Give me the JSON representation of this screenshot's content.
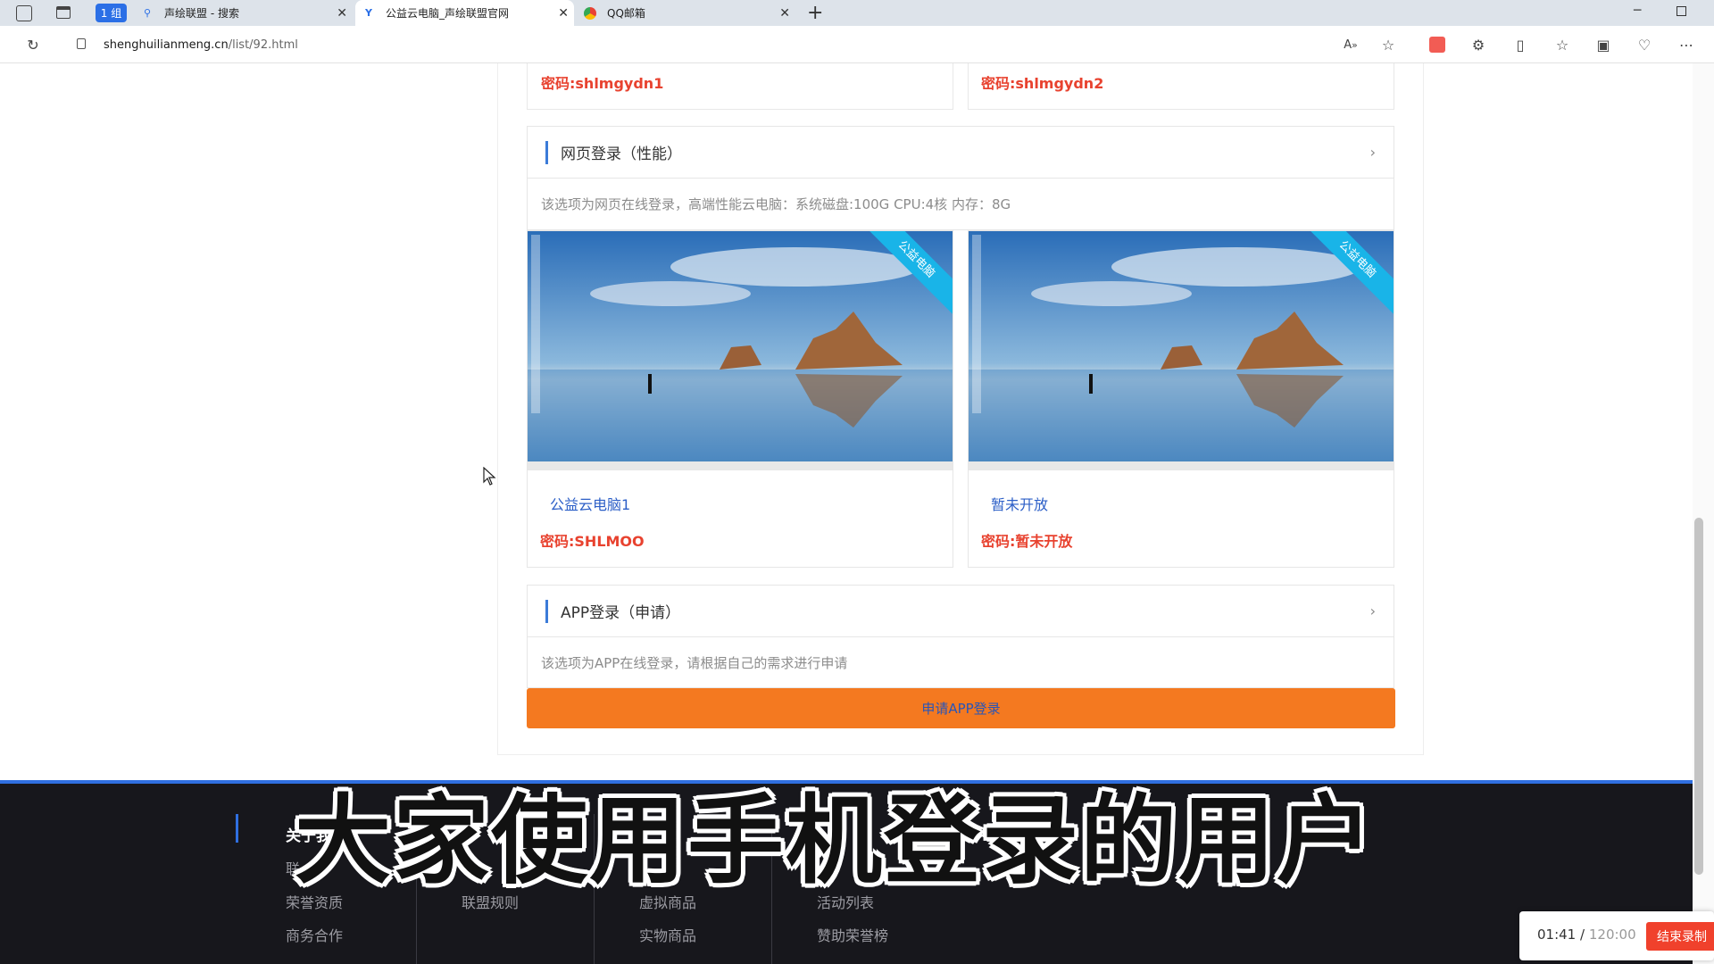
{
  "browser": {
    "tab_group_label": "1 组",
    "tabs": [
      {
        "title": "声绘联盟 - 搜索",
        "icon": "search-icon"
      },
      {
        "title": "公益云电脑_声绘联盟官网",
        "icon": "site-logo-icon"
      },
      {
        "title": "QQ邮箱",
        "icon": "chrome-icon"
      }
    ],
    "url_host": "shenghuilianmeng.cn",
    "url_path": "/list/92.html"
  },
  "top_row": {
    "pwd_left": "密码:shlmgydn1",
    "pwd_right": "密码:shlmgydn2"
  },
  "web_section": {
    "title": "网页登录（性能）",
    "description": "该选项为网页在线登录，高端性能云电脑：系统磁盘:100G CPU:4核 内存：8G",
    "cards": [
      {
        "name": "公益云电脑1",
        "password": "密码:SHLMOO",
        "ribbon": "公益电脑"
      },
      {
        "name": "暂未开放",
        "password": "密码:暂未开放",
        "ribbon": "公益电脑"
      }
    ]
  },
  "app_section": {
    "title": "APP登录（申请）",
    "description": "该选项为APP在线登录，请根据自己的需求进行申请",
    "button_label": "申请APP登录"
  },
  "footer": {
    "columns": [
      {
        "heading": "关于我",
        "links": [
          "联",
          "荣誉资质",
          "商务合作"
        ]
      },
      {
        "heading": "",
        "links": [
          "",
          "联盟规则"
        ]
      },
      {
        "heading": "",
        "links": [
          "",
          "虚拟商品",
          "实物商品"
        ]
      },
      {
        "heading": "",
        "links": [
          "",
          "活动列表",
          "赞助荣誉榜"
        ]
      }
    ]
  },
  "subtitle": "大家使用手机登录的用户",
  "recorder": {
    "elapsed": "01:41",
    "separator": "/",
    "total": "120:00",
    "stop_label": "结束录制"
  },
  "colors": {
    "accent_blue": "#3b7bd8",
    "password_red": "#e8422f",
    "button_orange": "#f47920",
    "footer_bg": "#17171c"
  }
}
